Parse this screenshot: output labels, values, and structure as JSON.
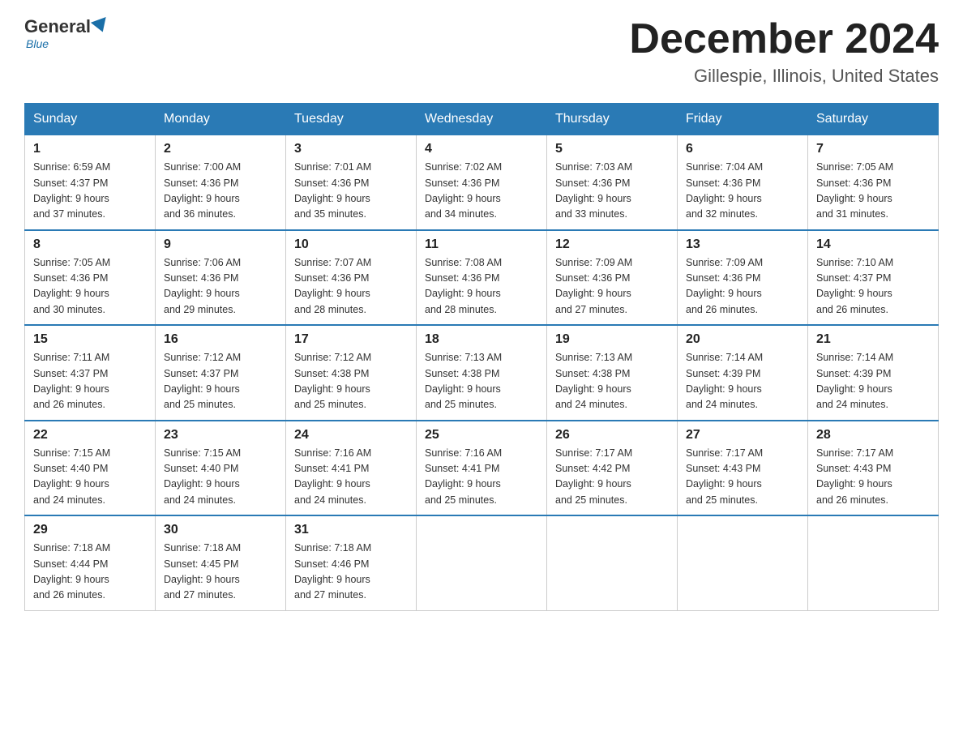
{
  "header": {
    "logo_general": "General",
    "logo_blue": "Blue",
    "month_title": "December 2024",
    "location": "Gillespie, Illinois, United States"
  },
  "days_of_week": [
    "Sunday",
    "Monday",
    "Tuesday",
    "Wednesday",
    "Thursday",
    "Friday",
    "Saturday"
  ],
  "weeks": [
    [
      {
        "day": "1",
        "sunrise": "6:59 AM",
        "sunset": "4:37 PM",
        "daylight": "9 hours and 37 minutes."
      },
      {
        "day": "2",
        "sunrise": "7:00 AM",
        "sunset": "4:36 PM",
        "daylight": "9 hours and 36 minutes."
      },
      {
        "day": "3",
        "sunrise": "7:01 AM",
        "sunset": "4:36 PM",
        "daylight": "9 hours and 35 minutes."
      },
      {
        "day": "4",
        "sunrise": "7:02 AM",
        "sunset": "4:36 PM",
        "daylight": "9 hours and 34 minutes."
      },
      {
        "day": "5",
        "sunrise": "7:03 AM",
        "sunset": "4:36 PM",
        "daylight": "9 hours and 33 minutes."
      },
      {
        "day": "6",
        "sunrise": "7:04 AM",
        "sunset": "4:36 PM",
        "daylight": "9 hours and 32 minutes."
      },
      {
        "day": "7",
        "sunrise": "7:05 AM",
        "sunset": "4:36 PM",
        "daylight": "9 hours and 31 minutes."
      }
    ],
    [
      {
        "day": "8",
        "sunrise": "7:05 AM",
        "sunset": "4:36 PM",
        "daylight": "9 hours and 30 minutes."
      },
      {
        "day": "9",
        "sunrise": "7:06 AM",
        "sunset": "4:36 PM",
        "daylight": "9 hours and 29 minutes."
      },
      {
        "day": "10",
        "sunrise": "7:07 AM",
        "sunset": "4:36 PM",
        "daylight": "9 hours and 28 minutes."
      },
      {
        "day": "11",
        "sunrise": "7:08 AM",
        "sunset": "4:36 PM",
        "daylight": "9 hours and 28 minutes."
      },
      {
        "day": "12",
        "sunrise": "7:09 AM",
        "sunset": "4:36 PM",
        "daylight": "9 hours and 27 minutes."
      },
      {
        "day": "13",
        "sunrise": "7:09 AM",
        "sunset": "4:36 PM",
        "daylight": "9 hours and 26 minutes."
      },
      {
        "day": "14",
        "sunrise": "7:10 AM",
        "sunset": "4:37 PM",
        "daylight": "9 hours and 26 minutes."
      }
    ],
    [
      {
        "day": "15",
        "sunrise": "7:11 AM",
        "sunset": "4:37 PM",
        "daylight": "9 hours and 26 minutes."
      },
      {
        "day": "16",
        "sunrise": "7:12 AM",
        "sunset": "4:37 PM",
        "daylight": "9 hours and 25 minutes."
      },
      {
        "day": "17",
        "sunrise": "7:12 AM",
        "sunset": "4:38 PM",
        "daylight": "9 hours and 25 minutes."
      },
      {
        "day": "18",
        "sunrise": "7:13 AM",
        "sunset": "4:38 PM",
        "daylight": "9 hours and 25 minutes."
      },
      {
        "day": "19",
        "sunrise": "7:13 AM",
        "sunset": "4:38 PM",
        "daylight": "9 hours and 24 minutes."
      },
      {
        "day": "20",
        "sunrise": "7:14 AM",
        "sunset": "4:39 PM",
        "daylight": "9 hours and 24 minutes."
      },
      {
        "day": "21",
        "sunrise": "7:14 AM",
        "sunset": "4:39 PM",
        "daylight": "9 hours and 24 minutes."
      }
    ],
    [
      {
        "day": "22",
        "sunrise": "7:15 AM",
        "sunset": "4:40 PM",
        "daylight": "9 hours and 24 minutes."
      },
      {
        "day": "23",
        "sunrise": "7:15 AM",
        "sunset": "4:40 PM",
        "daylight": "9 hours and 24 minutes."
      },
      {
        "day": "24",
        "sunrise": "7:16 AM",
        "sunset": "4:41 PM",
        "daylight": "9 hours and 24 minutes."
      },
      {
        "day": "25",
        "sunrise": "7:16 AM",
        "sunset": "4:41 PM",
        "daylight": "9 hours and 25 minutes."
      },
      {
        "day": "26",
        "sunrise": "7:17 AM",
        "sunset": "4:42 PM",
        "daylight": "9 hours and 25 minutes."
      },
      {
        "day": "27",
        "sunrise": "7:17 AM",
        "sunset": "4:43 PM",
        "daylight": "9 hours and 25 minutes."
      },
      {
        "day": "28",
        "sunrise": "7:17 AM",
        "sunset": "4:43 PM",
        "daylight": "9 hours and 26 minutes."
      }
    ],
    [
      {
        "day": "29",
        "sunrise": "7:18 AM",
        "sunset": "4:44 PM",
        "daylight": "9 hours and 26 minutes."
      },
      {
        "day": "30",
        "sunrise": "7:18 AM",
        "sunset": "4:45 PM",
        "daylight": "9 hours and 27 minutes."
      },
      {
        "day": "31",
        "sunrise": "7:18 AM",
        "sunset": "4:46 PM",
        "daylight": "9 hours and 27 minutes."
      },
      null,
      null,
      null,
      null
    ]
  ]
}
